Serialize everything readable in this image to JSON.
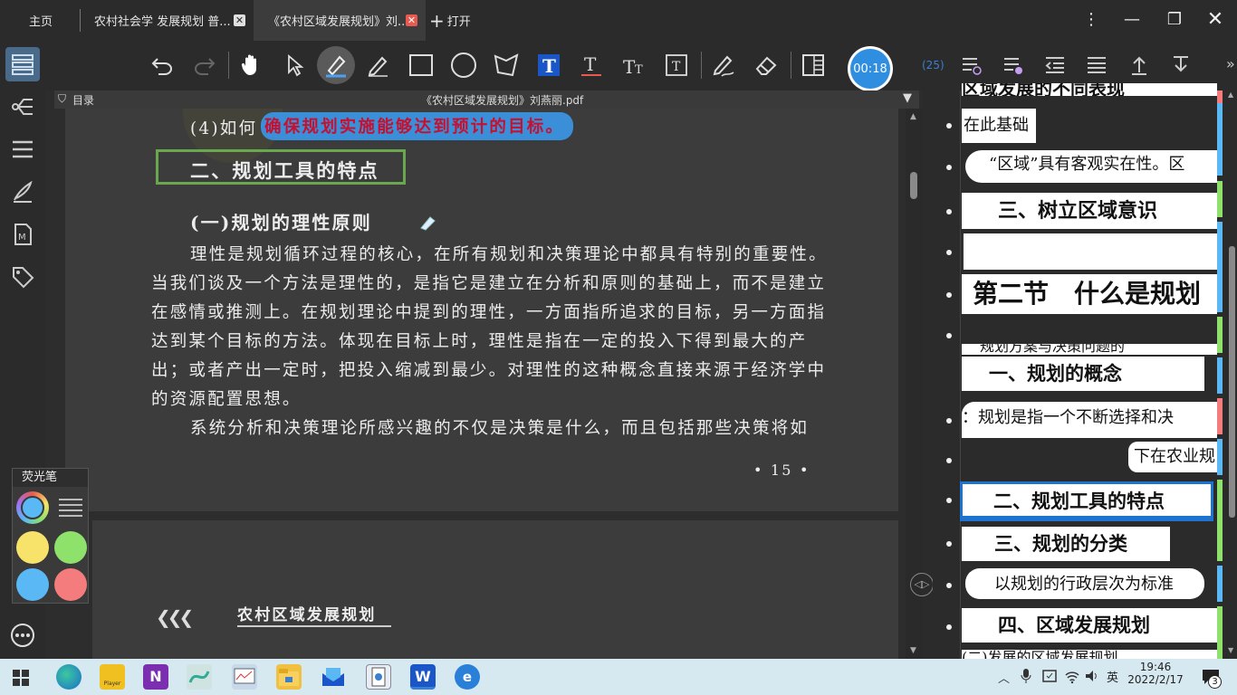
{
  "titlebar": {
    "home_tab": "主页",
    "tab1": "农村社会学 发展规划 普...",
    "tab2": "《农村区域发展规划》刘...",
    "open_label": "打开"
  },
  "toolbar": {
    "timer": "00:18"
  },
  "right_toolbar": {
    "count": "(25)"
  },
  "doc": {
    "toc_label": "目录",
    "filename": "《农村区域发展规划》刘燕丽.pdf",
    "q4_prefix": "(4)如何",
    "q4_highlight": "确保规划实施能够达到预计的目标。",
    "section_title": "二、规划工具的特点",
    "subsection_title": "(一)规划的理性原则",
    "para_lines": [
      "理性是规划循环过程的核心，在所有规划和决策理论中都具有特别的重要性。",
      "当我们谈及一个方法是理性的，是指它是建立在分析和原则的基础上，而不是建立",
      "在感情或推测上。在规划理论中提到的理性，一方面指所追求的目标，另一方面指",
      "达到某个目标的方法。体现在目标上时，理性是指在一定的投入下得到最大的产",
      "出；或者产出一定时，把投入缩减到最少。对理性的这种概念直接来源于经济学中",
      "的资源配置思想。"
    ],
    "para2_line": "系统分析和决策理论所感兴趣的不仅是决策是什么，而且包括那些决策将如",
    "page_number": "•  15  •",
    "page2_header": "农村区域发展规划"
  },
  "notes": [
    {
      "text": "区域发展的不同表现",
      "size": 20,
      "bold": true
    },
    {
      "text": "在此基础",
      "size": 18,
      "bold": false
    },
    {
      "text": "“区域”具有客观实在性。区",
      "size": 18,
      "bold": false
    },
    {
      "text": "三、树立区域意识",
      "size": 22,
      "bold": true
    },
    {
      "text": "",
      "size": 18,
      "bold": false
    },
    {
      "text": "第二节　什么是规划",
      "size": 28,
      "bold": true
    },
    {
      "text": "规划方案与决策问题的",
      "size": 16,
      "bold": false
    },
    {
      "text": "一、规划的概念",
      "size": 21,
      "bold": true
    },
    {
      "text": "：规划是指一个不断选择和决",
      "size": 18,
      "bold": false
    },
    {
      "text": "下在农业规",
      "size": 18,
      "bold": false
    },
    {
      "text": "二、规划工具的特点",
      "size": 21,
      "bold": true
    },
    {
      "text": "三、规划的分类",
      "size": 21,
      "bold": true
    },
    {
      "text": "以规划的行政层次为标准",
      "size": 18,
      "bold": false
    },
    {
      "text": "四、区域发展规划",
      "size": 21,
      "bold": true
    },
    {
      "text": "(二)发展的区域发展规划",
      "size": 16,
      "bold": false
    }
  ],
  "highlighter": {
    "title": "荧光笔",
    "colors": [
      "#f7e36a",
      "#8ee26b",
      "#5ab8f5",
      "#f47c7c"
    ]
  },
  "taskbar": {
    "ime": "英",
    "time": "19:46",
    "date": "2022/2/17",
    "notif_count": "3",
    "player_label": "Player"
  },
  "colors": {
    "accent_blue": "#1e73d0",
    "section_box": "#6aa84f",
    "highlight": "#3a8fd8"
  }
}
